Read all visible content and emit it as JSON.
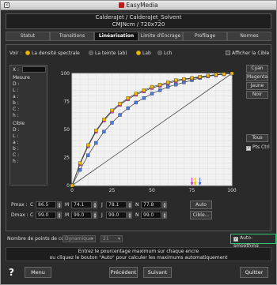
{
  "window": {
    "title": "EasyMedia"
  },
  "header": {
    "line1": "CalderaJet / CalderaJet_Solvent",
    "line2": "CMJNcm / 720x720"
  },
  "tabs": [
    {
      "label": "Statut"
    },
    {
      "label": "Transitions"
    },
    {
      "label": "Linéarisation"
    },
    {
      "label": "Limite d'Encrage"
    },
    {
      "label": "Profilage"
    },
    {
      "label": "Normes"
    }
  ],
  "voir": {
    "label": "Voir :",
    "opt1": "La densité spectrale",
    "opt2": "La teinte (ab)",
    "opt3": "Lab",
    "opt4": "Lch",
    "afficher": "Afficher la Cible"
  },
  "info": {
    "x_label": "X :",
    "mesure": "Mesure",
    "d": "D :",
    "l": "L :",
    "a": "a :",
    "b": "b :",
    "c": "C :",
    "h": "h :",
    "cible": "Cible",
    "d2": "D :",
    "l2": "L :",
    "a2": "a :",
    "b2": "b :",
    "c2": "C :",
    "h2": "h :"
  },
  "side": {
    "cyan": "Cyan",
    "magenta": "Magenta",
    "jaune": "Jaune",
    "noir": "Noir",
    "tous": "Tous",
    "ptsctrl": "Pts Ctrl",
    "check": "✓"
  },
  "chart_data": {
    "type": "line",
    "x": [
      0,
      5,
      10,
      15,
      20,
      25,
      30,
      35,
      40,
      45,
      50,
      55,
      60,
      65,
      70,
      75,
      80,
      85,
      90,
      95,
      100
    ],
    "series": [
      {
        "color": "#f0b800",
        "values": [
          0,
          20,
          36,
          49,
          59,
          67,
          73,
          78,
          82,
          85,
          88,
          90,
          92,
          94,
          95,
          96,
          97,
          98,
          99,
          99.5,
          100
        ]
      },
      {
        "color": "#e040c0",
        "values": [
          0,
          19,
          35,
          48,
          58,
          66,
          72,
          77,
          81,
          84,
          87,
          89,
          91,
          93,
          94.5,
          95.5,
          96.5,
          97.5,
          98.5,
          99.3,
          100
        ]
      },
      {
        "color": "#4a7adf",
        "values": [
          0,
          14,
          27,
          38,
          48,
          56,
          63,
          69,
          74,
          78,
          82,
          85,
          88,
          90,
          92,
          94,
          96,
          97.5,
          98.5,
          99.3,
          100
        ]
      }
    ],
    "xticks": [
      "0",
      "25",
      "50",
      "75",
      "100"
    ],
    "yticks": [
      "0",
      "25",
      "50",
      "75",
      "100"
    ],
    "xlim": [
      0,
      100
    ],
    "ylim": [
      0,
      100
    ],
    "grid": true,
    "markers": [
      {
        "x": 75,
        "color": "#c040c0"
      },
      {
        "x": 77,
        "color": "#f0c000"
      },
      {
        "x": 80,
        "color": "#4060e0"
      }
    ]
  },
  "pmax": {
    "label": "Pmax :",
    "c_lbl": "C",
    "c": "86.5",
    "m_lbl": "M",
    "m": "74.1",
    "j_lbl": "J",
    "j": "78.1",
    "n_lbl": "N",
    "n": "77.8",
    "btn": "Auto"
  },
  "dmax": {
    "label": "Dmax :",
    "c_lbl": "C",
    "c": "99.0",
    "m_lbl": "M",
    "m": "99.0",
    "j_lbl": "J",
    "j": "99.0",
    "n_lbl": "N",
    "n": "99.0",
    "btn": "Cible..."
  },
  "points": {
    "label": "Nombre de points de contrôle :",
    "mode": "Dynamique",
    "count": "21",
    "autosmoothing": "Auto-smoothing",
    "check": "✓"
  },
  "note": {
    "line1": "Entrez le pourcentage maximum sur chaque encre",
    "line2": "ou cliquez le bouton \"Auto\" pour calculer les maximums automatiquement"
  },
  "footer": {
    "help": "?",
    "menu": "Menu",
    "prev": "Précédent",
    "next": "Suivant",
    "quit": "Quitter"
  }
}
